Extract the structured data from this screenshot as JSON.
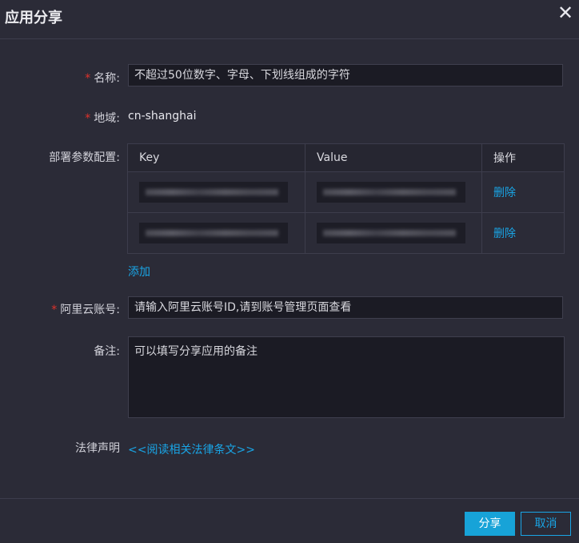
{
  "dialog": {
    "title": "应用分享",
    "close_icon": "close-icon"
  },
  "form": {
    "name": {
      "label": "名称:",
      "placeholder": "不超过50位数字、字母、下划线组成的字符",
      "required": true
    },
    "region": {
      "label": "地域:",
      "value": "cn-shanghai",
      "required": true
    },
    "params": {
      "label": "部署参数配置:",
      "columns": [
        "Key",
        "Value",
        "操作"
      ],
      "rows": [
        {
          "action": "删除"
        },
        {
          "action": "删除"
        }
      ],
      "add_label": "添加"
    },
    "account": {
      "label": "阿里云账号:",
      "placeholder": "请输入阿里云账号ID,请到账号管理页面查看",
      "required": true
    },
    "remark": {
      "label": "备注:",
      "placeholder": "可以填写分享应用的备注"
    },
    "legal": {
      "label": "法律声明",
      "link": "<<阅读相关法律条文>>"
    }
  },
  "footer": {
    "share_label": "分享",
    "cancel_label": "取消"
  },
  "colors": {
    "accent": "#17a3d8",
    "required": "#e0322b",
    "background": "#2b2b37"
  }
}
